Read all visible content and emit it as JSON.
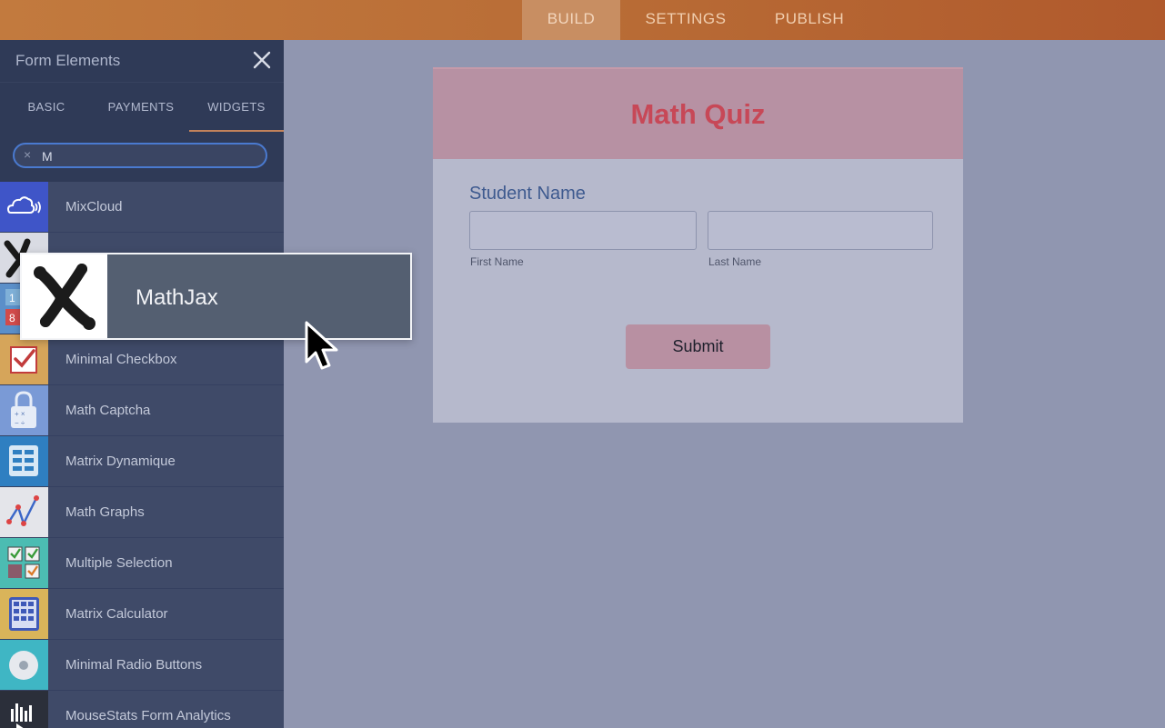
{
  "topbar": {
    "tabs": [
      {
        "label": "BUILD",
        "active": true
      },
      {
        "label": "SETTINGS",
        "active": false
      },
      {
        "label": "PUBLISH",
        "active": false
      }
    ]
  },
  "panel": {
    "title": "Form Elements",
    "tabs": [
      {
        "label": "BASIC"
      },
      {
        "label": "PAYMENTS"
      },
      {
        "label": "WIDGETS",
        "active": true
      }
    ],
    "search": {
      "value": "M"
    },
    "items": [
      {
        "label": "MixCloud",
        "icon": "cloud-icon"
      },
      {
        "label": "",
        "icon": "mathjax-icon"
      },
      {
        "label": "",
        "icon": "number-grid-icon"
      },
      {
        "label": "Minimal Checkbox",
        "icon": "checkbox-icon"
      },
      {
        "label": "Math Captcha",
        "icon": "lock-icon"
      },
      {
        "label": "Matrix Dynamique",
        "icon": "matrix-icon"
      },
      {
        "label": "Math Graphs",
        "icon": "graph-icon"
      },
      {
        "label": "Multiple Selection",
        "icon": "multi-select-icon"
      },
      {
        "label": "Matrix Calculator",
        "icon": "calculator-icon"
      },
      {
        "label": "Minimal Radio Buttons",
        "icon": "radio-icon"
      },
      {
        "label": "MouseStats Form Analytics",
        "icon": "analytics-icon"
      }
    ]
  },
  "form": {
    "title": "Math Quiz",
    "field_label": "Student Name",
    "first_label": "First Name",
    "last_label": "Last Name",
    "submit_label": "Submit"
  },
  "drag": {
    "label": "MathJax",
    "icon": "mathjax-icon"
  },
  "colors": {
    "topbar": "#b86b35",
    "panel": "#3f4a68",
    "accent_tab": "#c3825b",
    "title": "#c74857",
    "field_label": "#3e5a8f"
  }
}
